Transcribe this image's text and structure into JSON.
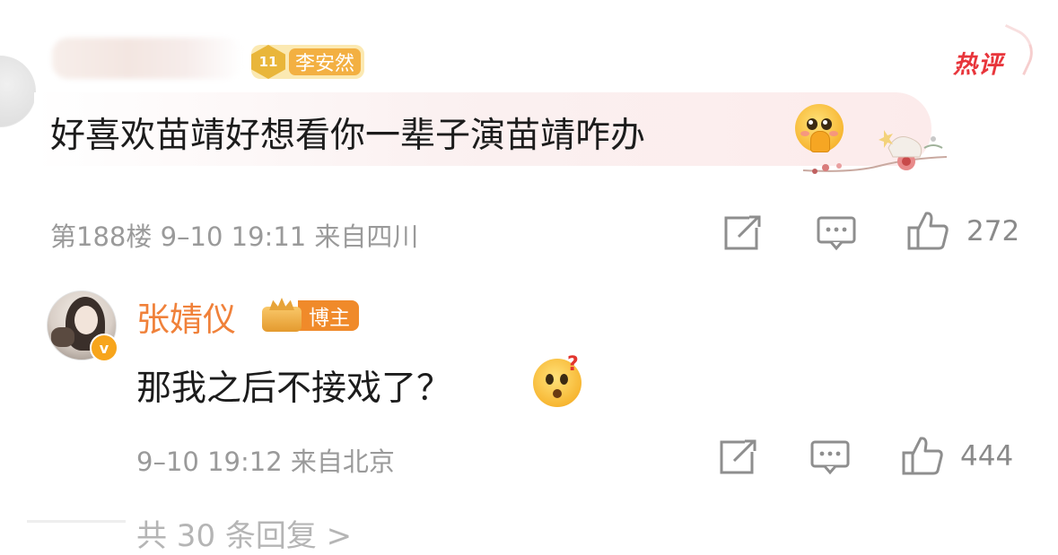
{
  "comment": {
    "user_badge_level": "11",
    "user_badge_text": "李安然",
    "hot_tag": "热评",
    "text": "好喜欢苗靖好想看你一辈子演苗靖咋办",
    "emoji": "pleading-face",
    "meta": "第188楼  9–10 19:11  来自四川",
    "like_count": "272"
  },
  "reply": {
    "author": "张婧仪",
    "author_badge": "博主",
    "verified_mark": "v",
    "text": "那我之后不接戏了？",
    "emoji": "thinking-question-face",
    "meta": "9–10 19:12  来自北京",
    "like_count": "444"
  },
  "footer": {
    "more_replies": "共 30 条回复 >"
  },
  "colors": {
    "accent_orange": "#f0813a",
    "hot_red": "#e8353b",
    "meta_gray": "#9a9a9a"
  },
  "icons": [
    "share-icon",
    "comment-icon",
    "like-icon",
    "verified-icon",
    "crown-icon"
  ]
}
